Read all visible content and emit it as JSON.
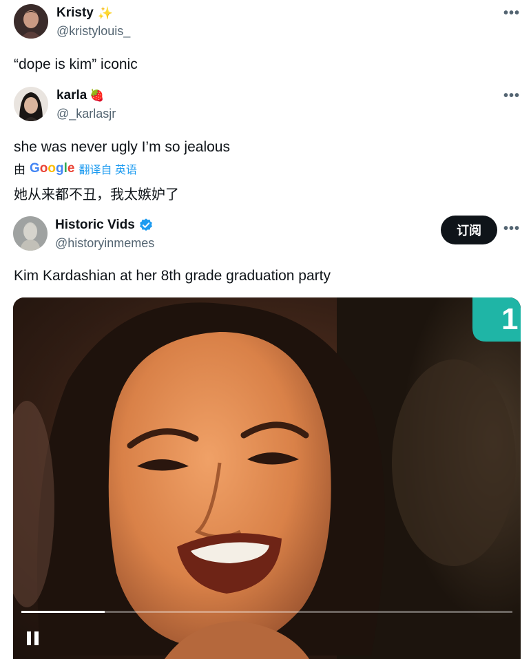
{
  "tweets": [
    {
      "display_name": "Kristy",
      "badge": "✨",
      "handle": "@kristylouis_",
      "text": "“dope is kim” iconic",
      "avatar_icon": "user-avatar-icon"
    },
    {
      "display_name": "karla",
      "badge": "🍓",
      "handle": "@_karlasjr",
      "text": "she was never ugly I’m so jealous",
      "translation": {
        "prefix": "由",
        "provider": "Google",
        "link_text": "翻译自 英语",
        "translated_text": "她从来都不丑，我太嫉妒了"
      },
      "avatar_icon": "user-avatar-icon"
    },
    {
      "display_name": "Historic Vids",
      "handle": "@historyinmemes",
      "text": "Kim Kardashian at her 8th grade graduation party",
      "subscribe_label": "订阅",
      "verified_icon": "verified-badge-icon",
      "avatar_icon": "bust-avatar-icon"
    }
  ],
  "more_label": "•••",
  "video": {
    "progress": 0.17,
    "channel_badge": "1",
    "pause_icon": "pause-icon"
  },
  "colors": {
    "verified": "#1d9bf0",
    "google_blue": "#4285f4",
    "google_red": "#ea4335",
    "google_yellow": "#fbbc05",
    "google_green": "#34a853",
    "translate_link": "#1d9bf0",
    "channel_badge": "#1fb5a6"
  }
}
